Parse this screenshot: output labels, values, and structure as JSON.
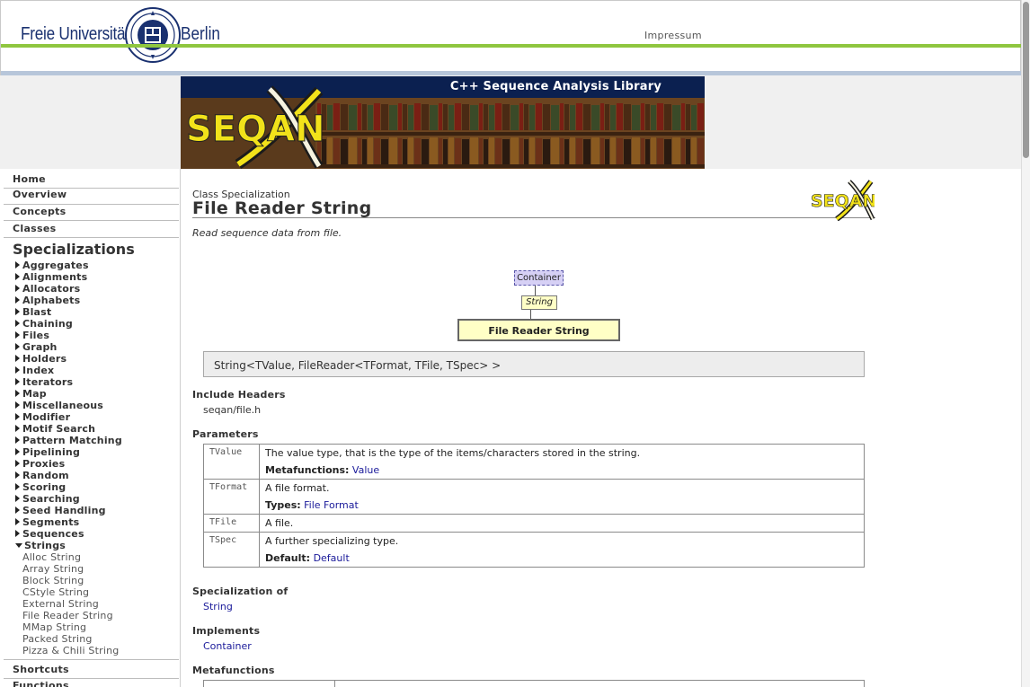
{
  "header": {
    "logo_left": "Freie Universität",
    "logo_right": "Berlin",
    "impressum": "Impressum"
  },
  "banner": {
    "title": "C++ Sequence Analysis Library",
    "logo_text": "SEQAN"
  },
  "sidebar": {
    "top_links": [
      "Home",
      "Overview",
      "Concepts",
      "Classes"
    ],
    "section_title": "Specializations",
    "categories": [
      "Aggregates",
      "Alignments",
      "Allocators",
      "Alphabets",
      "Blast",
      "Chaining",
      "Files",
      "Graph",
      "Holders",
      "Index",
      "Iterators",
      "Map",
      "Miscellaneous",
      "Modifier",
      "Motif Search",
      "Pattern Matching",
      "Pipelining",
      "Proxies",
      "Random",
      "Scoring",
      "Searching",
      "Seed Handling",
      "Segments",
      "Sequences",
      "Strings"
    ],
    "expanded_category": "Strings",
    "sub_items": [
      "Alloc String",
      "Array String",
      "Block String",
      "CStyle String",
      "External String",
      "File Reader String",
      "MMap String",
      "Packed String",
      "Pizza & Chili String"
    ],
    "bottom_links": [
      "Shortcuts",
      "Functions"
    ]
  },
  "page": {
    "kind": "Class Specialization",
    "title": "File Reader String",
    "summary": "Read sequence data from file.",
    "diagram": {
      "top": "Container",
      "middle": "String",
      "bottom": "File Reader String"
    },
    "signature": "String<TValue, FileReader<TFormat, TFile, TSpec> >",
    "include_headers_label": "Include Headers",
    "include_headers_value": "seqan/file.h",
    "parameters_label": "Parameters",
    "parameters": [
      {
        "name": "TValue",
        "desc": "The value type, that is the type of the items/characters stored in the string.",
        "extra_label": "Metafunctions:",
        "extra_link": "Value"
      },
      {
        "name": "TFormat",
        "desc": "A file format.",
        "extra_label": "Types:",
        "extra_link": "File Format"
      },
      {
        "name": "TFile",
        "desc": "A file.",
        "extra_label": "",
        "extra_link": ""
      },
      {
        "name": "TSpec",
        "desc": "A further specializing type.",
        "extra_label": "Default:",
        "extra_link": "Default"
      }
    ],
    "specialization_of_label": "Specialization of",
    "specialization_of_value": "String",
    "implements_label": "Implements",
    "implements_value": "Container",
    "metafunctions_label": "Metafunctions"
  }
}
